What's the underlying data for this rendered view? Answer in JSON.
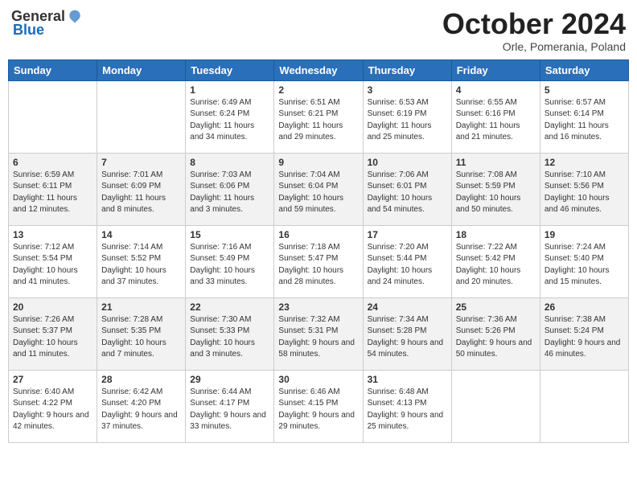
{
  "logo": {
    "general": "General",
    "blue": "Blue"
  },
  "title": "October 2024",
  "subtitle": "Orle, Pomerania, Poland",
  "days_header": [
    "Sunday",
    "Monday",
    "Tuesday",
    "Wednesday",
    "Thursday",
    "Friday",
    "Saturday"
  ],
  "weeks": [
    [
      {
        "day": "",
        "sunrise": "",
        "sunset": "",
        "daylight": ""
      },
      {
        "day": "",
        "sunrise": "",
        "sunset": "",
        "daylight": ""
      },
      {
        "day": "1",
        "sunrise": "Sunrise: 6:49 AM",
        "sunset": "Sunset: 6:24 PM",
        "daylight": "Daylight: 11 hours and 34 minutes."
      },
      {
        "day": "2",
        "sunrise": "Sunrise: 6:51 AM",
        "sunset": "Sunset: 6:21 PM",
        "daylight": "Daylight: 11 hours and 29 minutes."
      },
      {
        "day": "3",
        "sunrise": "Sunrise: 6:53 AM",
        "sunset": "Sunset: 6:19 PM",
        "daylight": "Daylight: 11 hours and 25 minutes."
      },
      {
        "day": "4",
        "sunrise": "Sunrise: 6:55 AM",
        "sunset": "Sunset: 6:16 PM",
        "daylight": "Daylight: 11 hours and 21 minutes."
      },
      {
        "day": "5",
        "sunrise": "Sunrise: 6:57 AM",
        "sunset": "Sunset: 6:14 PM",
        "daylight": "Daylight: 11 hours and 16 minutes."
      }
    ],
    [
      {
        "day": "6",
        "sunrise": "Sunrise: 6:59 AM",
        "sunset": "Sunset: 6:11 PM",
        "daylight": "Daylight: 11 hours and 12 minutes."
      },
      {
        "day": "7",
        "sunrise": "Sunrise: 7:01 AM",
        "sunset": "Sunset: 6:09 PM",
        "daylight": "Daylight: 11 hours and 8 minutes."
      },
      {
        "day": "8",
        "sunrise": "Sunrise: 7:03 AM",
        "sunset": "Sunset: 6:06 PM",
        "daylight": "Daylight: 11 hours and 3 minutes."
      },
      {
        "day": "9",
        "sunrise": "Sunrise: 7:04 AM",
        "sunset": "Sunset: 6:04 PM",
        "daylight": "Daylight: 10 hours and 59 minutes."
      },
      {
        "day": "10",
        "sunrise": "Sunrise: 7:06 AM",
        "sunset": "Sunset: 6:01 PM",
        "daylight": "Daylight: 10 hours and 54 minutes."
      },
      {
        "day": "11",
        "sunrise": "Sunrise: 7:08 AM",
        "sunset": "Sunset: 5:59 PM",
        "daylight": "Daylight: 10 hours and 50 minutes."
      },
      {
        "day": "12",
        "sunrise": "Sunrise: 7:10 AM",
        "sunset": "Sunset: 5:56 PM",
        "daylight": "Daylight: 10 hours and 46 minutes."
      }
    ],
    [
      {
        "day": "13",
        "sunrise": "Sunrise: 7:12 AM",
        "sunset": "Sunset: 5:54 PM",
        "daylight": "Daylight: 10 hours and 41 minutes."
      },
      {
        "day": "14",
        "sunrise": "Sunrise: 7:14 AM",
        "sunset": "Sunset: 5:52 PM",
        "daylight": "Daylight: 10 hours and 37 minutes."
      },
      {
        "day": "15",
        "sunrise": "Sunrise: 7:16 AM",
        "sunset": "Sunset: 5:49 PM",
        "daylight": "Daylight: 10 hours and 33 minutes."
      },
      {
        "day": "16",
        "sunrise": "Sunrise: 7:18 AM",
        "sunset": "Sunset: 5:47 PM",
        "daylight": "Daylight: 10 hours and 28 minutes."
      },
      {
        "day": "17",
        "sunrise": "Sunrise: 7:20 AM",
        "sunset": "Sunset: 5:44 PM",
        "daylight": "Daylight: 10 hours and 24 minutes."
      },
      {
        "day": "18",
        "sunrise": "Sunrise: 7:22 AM",
        "sunset": "Sunset: 5:42 PM",
        "daylight": "Daylight: 10 hours and 20 minutes."
      },
      {
        "day": "19",
        "sunrise": "Sunrise: 7:24 AM",
        "sunset": "Sunset: 5:40 PM",
        "daylight": "Daylight: 10 hours and 15 minutes."
      }
    ],
    [
      {
        "day": "20",
        "sunrise": "Sunrise: 7:26 AM",
        "sunset": "Sunset: 5:37 PM",
        "daylight": "Daylight: 10 hours and 11 minutes."
      },
      {
        "day": "21",
        "sunrise": "Sunrise: 7:28 AM",
        "sunset": "Sunset: 5:35 PM",
        "daylight": "Daylight: 10 hours and 7 minutes."
      },
      {
        "day": "22",
        "sunrise": "Sunrise: 7:30 AM",
        "sunset": "Sunset: 5:33 PM",
        "daylight": "Daylight: 10 hours and 3 minutes."
      },
      {
        "day": "23",
        "sunrise": "Sunrise: 7:32 AM",
        "sunset": "Sunset: 5:31 PM",
        "daylight": "Daylight: 9 hours and 58 minutes."
      },
      {
        "day": "24",
        "sunrise": "Sunrise: 7:34 AM",
        "sunset": "Sunset: 5:28 PM",
        "daylight": "Daylight: 9 hours and 54 minutes."
      },
      {
        "day": "25",
        "sunrise": "Sunrise: 7:36 AM",
        "sunset": "Sunset: 5:26 PM",
        "daylight": "Daylight: 9 hours and 50 minutes."
      },
      {
        "day": "26",
        "sunrise": "Sunrise: 7:38 AM",
        "sunset": "Sunset: 5:24 PM",
        "daylight": "Daylight: 9 hours and 46 minutes."
      }
    ],
    [
      {
        "day": "27",
        "sunrise": "Sunrise: 6:40 AM",
        "sunset": "Sunset: 4:22 PM",
        "daylight": "Daylight: 9 hours and 42 minutes."
      },
      {
        "day": "28",
        "sunrise": "Sunrise: 6:42 AM",
        "sunset": "Sunset: 4:20 PM",
        "daylight": "Daylight: 9 hours and 37 minutes."
      },
      {
        "day": "29",
        "sunrise": "Sunrise: 6:44 AM",
        "sunset": "Sunset: 4:17 PM",
        "daylight": "Daylight: 9 hours and 33 minutes."
      },
      {
        "day": "30",
        "sunrise": "Sunrise: 6:46 AM",
        "sunset": "Sunset: 4:15 PM",
        "daylight": "Daylight: 9 hours and 29 minutes."
      },
      {
        "day": "31",
        "sunrise": "Sunrise: 6:48 AM",
        "sunset": "Sunset: 4:13 PM",
        "daylight": "Daylight: 9 hours and 25 minutes."
      },
      {
        "day": "",
        "sunrise": "",
        "sunset": "",
        "daylight": ""
      },
      {
        "day": "",
        "sunrise": "",
        "sunset": "",
        "daylight": ""
      }
    ]
  ]
}
